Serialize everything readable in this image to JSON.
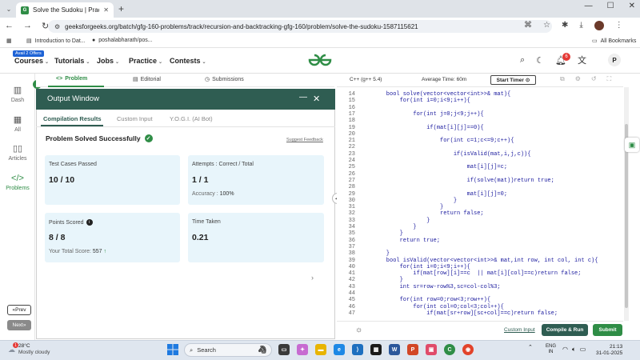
{
  "browser": {
    "tab_title": "Solve the Sudoku | Practice | Ge",
    "url": "geeksforgeeks.org/batch/gfg-160-problems/track/recursion-and-backtracking-gfg-160/problem/solve-the-sudoku-1587115621",
    "bookmarks": [
      "Introduction to Dat...",
      "poshalabharath/pos..."
    ],
    "all_bookmarks": "All Bookmarks"
  },
  "header": {
    "offer_badge": "Avail 2 Offers",
    "nav": [
      "Courses",
      "Tutorials",
      "Jobs",
      "Practice",
      "Contests"
    ],
    "logo_text": "GG",
    "notification_count": "6",
    "profile_initial": "P"
  },
  "sidebar": {
    "items": [
      "Dash",
      "All",
      "Articles",
      "Problems"
    ],
    "prev": "Prev",
    "next": "Next"
  },
  "problem_tabs": [
    "Problem",
    "Editorial",
    "Submissions"
  ],
  "output": {
    "title": "Output Window",
    "tabs": [
      "Compilation Results",
      "Custom Input",
      "Y.O.G.I. (AI Bot)"
    ],
    "status": "Problem Solved Successfully",
    "suggest_feedback": "Suggest Feedback",
    "test_cases_label": "Test Cases Passed",
    "test_cases_value": "10 / 10",
    "attempts_label": "Attempts : Correct / Total",
    "attempts_value": "1 / 1",
    "accuracy_label": "Accuracy :",
    "accuracy_value": "100%",
    "points_label": "Points Scored",
    "points_value": "8 / 8",
    "total_score_label": "Your Total Score:",
    "total_score_value": "557",
    "time_label": "Time Taken",
    "time_value": "0.21"
  },
  "editor": {
    "language": "C++ (g++ 5.4)",
    "avg_time": "Average Time: 60m",
    "start_timer": "Start Timer",
    "lines": [
      {
        "n": "14",
        "code": "    bool solve(vector<vector<int>>& mat){"
      },
      {
        "n": "15",
        "code": "        for(int i=0;i<9;i++){"
      },
      {
        "n": "16",
        "code": ""
      },
      {
        "n": "17",
        "code": "            for(int j=0;j<9;j++){"
      },
      {
        "n": "18",
        "code": ""
      },
      {
        "n": "19",
        "code": "                if(mat[i][j]==0){"
      },
      {
        "n": "20",
        "code": ""
      },
      {
        "n": "21",
        "code": "                    for(int c=1;c<=9;c++){"
      },
      {
        "n": "22",
        "code": ""
      },
      {
        "n": "23",
        "code": "                        if(isValid(mat,i,j,c)){"
      },
      {
        "n": "24",
        "code": ""
      },
      {
        "n": "25",
        "code": "                            mat[i][j]=c;"
      },
      {
        "n": "26",
        "code": ""
      },
      {
        "n": "27",
        "code": "                            if(solve(mat))return true;"
      },
      {
        "n": "28",
        "code": ""
      },
      {
        "n": "29",
        "code": "                            mat[i][j]=0;"
      },
      {
        "n": "30",
        "code": "                        }"
      },
      {
        "n": "31",
        "code": "                    }"
      },
      {
        "n": "32",
        "code": "                    return false;"
      },
      {
        "n": "33",
        "code": "                }"
      },
      {
        "n": "34",
        "code": "            }"
      },
      {
        "n": "35",
        "code": "        }"
      },
      {
        "n": "36",
        "code": "        return true;"
      },
      {
        "n": "37",
        "code": ""
      },
      {
        "n": "38",
        "code": "    }"
      },
      {
        "n": "39",
        "code": "    bool isValid(vector<vector<int>>& mat,int row, int col, int c){"
      },
      {
        "n": "40",
        "code": "        for(int i=0;i<9;i++){"
      },
      {
        "n": "41",
        "code": "            if(mat[row][i]==c  || mat[i][col]==c)return false;"
      },
      {
        "n": "42",
        "code": "        }"
      },
      {
        "n": "43",
        "code": "        int sr=row-row%3,sc=col-col%3;"
      },
      {
        "n": "44",
        "code": ""
      },
      {
        "n": "45",
        "code": "        for(int row=0;row<3;row++){"
      },
      {
        "n": "46",
        "code": "            for(int col=0;col<3;col++){"
      },
      {
        "n": "47",
        "code": "                if(mat[sr+row][sc+col]==c)return false;"
      }
    ],
    "custom_input": "Custom Input",
    "compile_run": "Compile & Run",
    "submit": "Submit"
  },
  "taskbar": {
    "temp": "28°C",
    "weather": "Mostly cloudy",
    "weather_badge": "1",
    "search": "Search",
    "lang": "ENG",
    "region": "IN",
    "time": "21:13",
    "date": "31-01-2025"
  },
  "colors": {
    "gfg_green": "#2f8d46",
    "output_header": "#2f5d52",
    "card_bg": "#e8f5fb"
  }
}
